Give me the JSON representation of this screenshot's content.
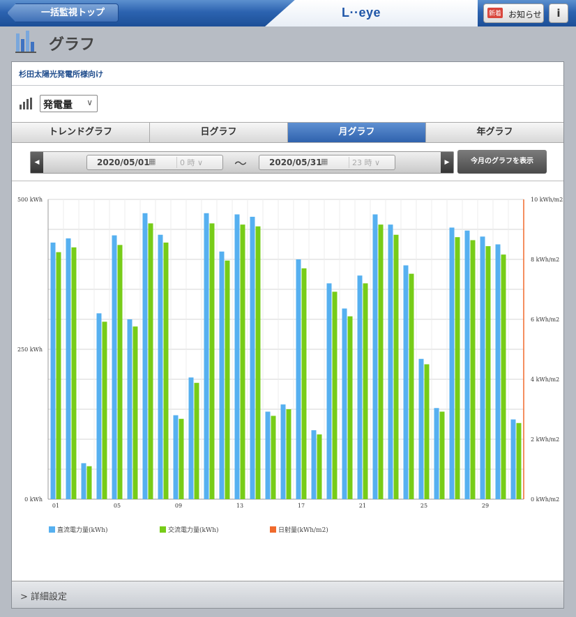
{
  "header": {
    "back_label": "一括監視トップ",
    "logo": "L··eye",
    "notice_badge": "新着",
    "notice_label": "お知らせ",
    "info_label": "i"
  },
  "page": {
    "title": "グラフ"
  },
  "panel": {
    "site_name": "杉田太陽光発電所様向け",
    "metric": "発電量",
    "footer_label": "詳細設定"
  },
  "tabs": [
    {
      "label": "トレンドグラフ"
    },
    {
      "label": "日グラフ"
    },
    {
      "label": "月グラフ"
    },
    {
      "label": "年グラフ"
    }
  ],
  "date_range": {
    "start_date": "2020/05/01",
    "start_hour": "0 時",
    "end_date": "2020/05/31",
    "end_hour": "23 時",
    "show_button": "今月のグラフを表示"
  },
  "colors": {
    "dc": "#56b0f0",
    "ac": "#77cc18",
    "irr": "#f06a2c",
    "active_tab": "#3a6db5"
  },
  "chart_data": {
    "type": "bar",
    "categories": [
      "01",
      "02",
      "03",
      "04",
      "05",
      "06",
      "07",
      "08",
      "09",
      "10",
      "11",
      "12",
      "13",
      "14",
      "15",
      "16",
      "17",
      "18",
      "19",
      "20",
      "21",
      "22",
      "23",
      "24",
      "25",
      "26",
      "27",
      "28",
      "29",
      "30",
      "31"
    ],
    "x_tick_labels": [
      "01",
      "05",
      "09",
      "13",
      "17",
      "21",
      "25",
      "29"
    ],
    "series": [
      {
        "name": "直流電力量(kWh)",
        "axis": "left",
        "values": [
          428,
          435,
          60,
          310,
          440,
          300,
          477,
          441,
          140,
          203,
          477,
          413,
          475,
          471,
          146,
          158,
          400,
          115,
          360,
          318,
          373,
          475,
          458,
          390,
          234,
          152,
          453,
          448,
          438,
          425,
          133
        ]
      },
      {
        "name": "交流電力量(kWh)",
        "axis": "left",
        "values": [
          412,
          420,
          55,
          296,
          424,
          288,
          460,
          428,
          134,
          194,
          460,
          398,
          458,
          455,
          139,
          150,
          385,
          108,
          346,
          305,
          360,
          458,
          441,
          376,
          225,
          146,
          437,
          432,
          422,
          408,
          127
        ]
      },
      {
        "name": "日射量(kWh/m2)",
        "axis": "right",
        "values": []
      }
    ],
    "left_axis": {
      "ylim": [
        0,
        500
      ],
      "tick_labels": [
        "0 kWh",
        "250 kWh",
        "500 kWh"
      ]
    },
    "right_axis": {
      "ylim": [
        0,
        10
      ],
      "tick_labels": [
        "0 kWh/m2",
        "2 kWh/m2",
        "4 kWh/m2",
        "6 kWh/m2",
        "8 kWh/m2",
        "10 kWh/m2"
      ]
    },
    "grid": true,
    "legend_position": "bottom-left"
  }
}
